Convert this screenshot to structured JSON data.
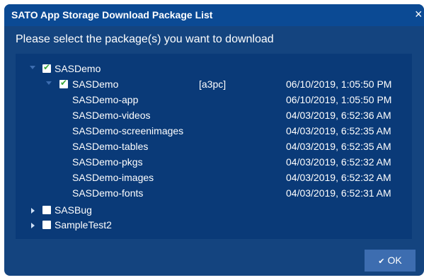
{
  "dialog": {
    "title": "SATO App Storage Download Package List",
    "close_glyph": "×",
    "subtitle": "Please select the package(s) you want to download"
  },
  "tree": {
    "root": {
      "label": "SASDemo",
      "checked": true,
      "expanded": true
    },
    "package": {
      "label": "SASDemo",
      "tag": "[a3pc]",
      "date": "06/10/2019, 1:05:50 PM",
      "checked": true,
      "expanded": true
    },
    "items": [
      {
        "label": "SASDemo-app",
        "date": "06/10/2019, 1:05:50 PM"
      },
      {
        "label": "SASDemo-videos",
        "date": "04/03/2019, 6:52:36 AM"
      },
      {
        "label": "SASDemo-screenimages",
        "date": "04/03/2019, 6:52:35 AM"
      },
      {
        "label": "SASDemo-tables",
        "date": "04/03/2019, 6:52:35 AM"
      },
      {
        "label": "SASDemo-pkgs",
        "date": "04/03/2019, 6:52:32 AM"
      },
      {
        "label": "SASDemo-images",
        "date": "04/03/2019, 6:52:32 AM"
      },
      {
        "label": "SASDemo-fonts",
        "date": "04/03/2019, 6:52:31 AM"
      }
    ],
    "other_roots": [
      {
        "label": "SASBug",
        "checked": false,
        "expanded": false
      },
      {
        "label": "SampleTest2",
        "checked": false,
        "expanded": false
      }
    ]
  },
  "footer": {
    "ok_label": "OK",
    "ok_icon": "check-icon"
  },
  "colors": {
    "dialog_bg": "#14447f",
    "titlebar_bg": "#0b4a94",
    "tree_bg": "#0a3a78",
    "button_bg": "#3d6db0",
    "check_green": "#3aa63a"
  }
}
